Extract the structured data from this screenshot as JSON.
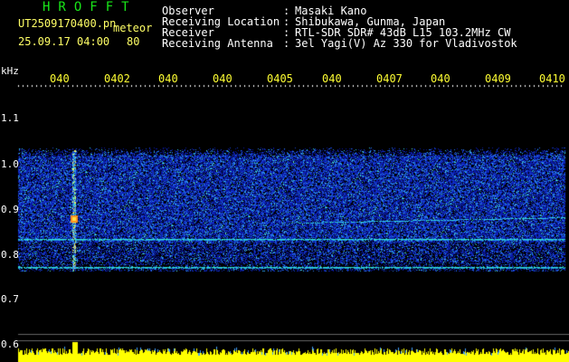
{
  "header": {
    "title": "HROFFT",
    "filename": "UT2509170400.pn",
    "mode": "meteor",
    "datetime": "25.09.17 04:00",
    "count": "80",
    "fields": [
      {
        "label": "Observer",
        "sep": ":",
        "value": "Masaki Kano"
      },
      {
        "label": "Receiving Location",
        "sep": ":",
        "value": "Shibukawa, Gunma, Japan"
      },
      {
        "label": "Receiver",
        "sep": ":",
        "value": "RTL-SDR SDR# 43dB L15 103.2MHz CW"
      },
      {
        "label": "Receiving Antenna",
        "sep": ":",
        "value": "3el Yagi(V) Az 330 for Vladivostok"
      }
    ]
  },
  "y_axis": {
    "unit": "kHz",
    "ticks": [
      "1.1",
      "1.0",
      "0.9",
      "0.8",
      "0.7",
      "0.6"
    ]
  },
  "x_axis": {
    "ticks": [
      "040",
      "0402",
      "040",
      "040",
      "0405",
      "040",
      "0407",
      "040",
      "0409",
      "0410"
    ]
  },
  "colors": {
    "background": "#000000",
    "title": "#19e619",
    "header_text": "#ffffff",
    "time_text": "#ffff33",
    "noise_base": "#0a1aa8",
    "signal_line": "#30e0d0",
    "power_bar": "#ffff00"
  }
}
